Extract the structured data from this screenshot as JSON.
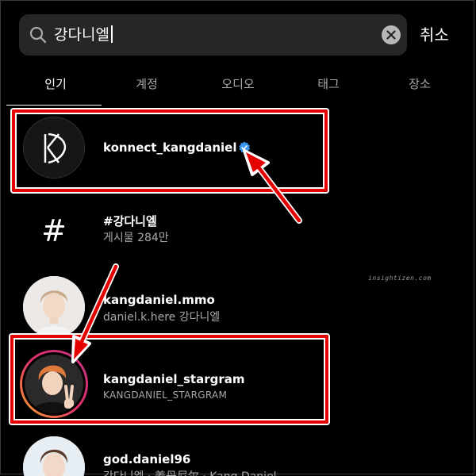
{
  "search": {
    "value": "강다니엘",
    "cancel_label": "취소"
  },
  "tabs": [
    {
      "label": "인기",
      "active": true
    },
    {
      "label": "계정",
      "active": false
    },
    {
      "label": "오디오",
      "active": false
    },
    {
      "label": "태그",
      "active": false
    },
    {
      "label": "장소",
      "active": false
    }
  ],
  "results": [
    {
      "name": "konnect_kangdaniel",
      "subtitle": "",
      "verified": true,
      "avatar": "konnect-logo"
    },
    {
      "name": "#강다니엘",
      "subtitle": "게시물 284만",
      "verified": false,
      "avatar": "hashtag"
    },
    {
      "name": "kangdaniel.mmo",
      "subtitle": "daniel.k.here 강다니엘",
      "verified": false,
      "avatar": "profile-photo"
    },
    {
      "name": "kangdaniel_stargram",
      "subtitle": "KANGDANIEL_STARGRAM",
      "verified": false,
      "avatar": "profile-photo-story-ring"
    },
    {
      "name": "god.daniel96",
      "subtitle": "강다니엘 · 姜丹尼尔 · Kang Daniel",
      "verified": false,
      "avatar": "profile-photo"
    }
  ],
  "hashtag_symbol": "#",
  "watermark": "insightizen.com",
  "colors": {
    "background": "#000000",
    "search_bg": "#262626",
    "verified_blue": "#3897f0",
    "annotation_red": "#e50000",
    "secondary_text": "#a8a8a8"
  }
}
